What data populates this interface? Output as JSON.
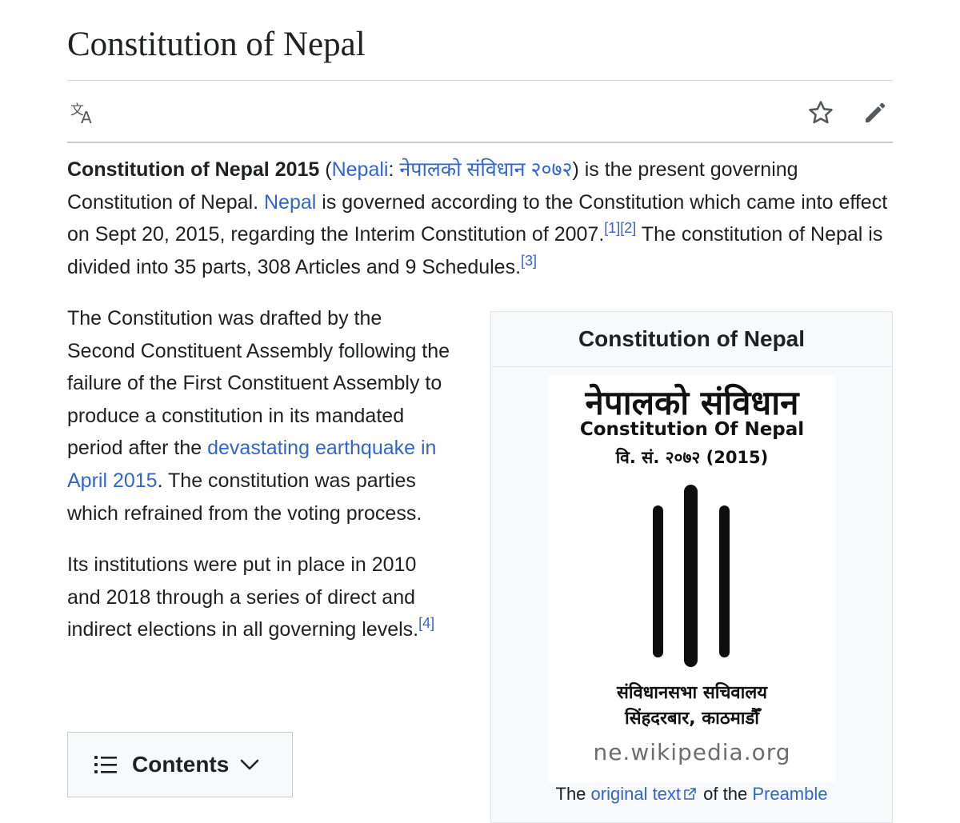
{
  "page": {
    "title": "Constitution of Nepal"
  },
  "toolbar": {
    "language_icon": "language-icon",
    "watch_icon": "star-icon",
    "edit_icon": "pencil-icon"
  },
  "intro": {
    "bold_title": "Constitution of Nepal 2015",
    "open_paren": " (",
    "lang_link": "Nepali",
    "colon": ": ",
    "native_link": "नेपालको संविधान २०७२",
    "after_native": ") is the present governing Constitution of Nepal. ",
    "nepal_link": "Nepal",
    "after_nepal": " is governed according to the Constitution which came into effect on Sept 20, 2015, regarding the Interim Constitution of 2007.",
    "ref1": "[1]",
    "ref2": "[2]",
    "after_refs": " The constitution of Nepal is divided into 35 parts, 308 Articles and 9 Schedules.",
    "ref3": "[3]"
  },
  "body": {
    "p1_before": "The Constitution was drafted by the Second Constituent Assembly following the failure of the First Constituent Assembly to produce a constitution in its mandated period after the ",
    "p1_link": "devastating earthquake in April 2015",
    "p1_after": ". The constitution was parties which refrained from the voting process.",
    "p2": "Its institutions were put in place in 2010 and 2018 through a series of direct and indirect elections in all governing levels.",
    "p2_ref": "[4]"
  },
  "toc": {
    "label": "Contents",
    "list_icon": "list-icon",
    "chevron_icon": "chevron-down-icon"
  },
  "infobox": {
    "title": "Constitution of Nepal",
    "image": {
      "line1": "नेपालको संविधान",
      "line2": "Constitution Of Nepal",
      "line3": "वि. सं. २०७२ (2015)",
      "line4": "संविधानसभा सचिवालय",
      "line5": "सिंहदरबार, काठमाडौँ",
      "watermark": "ne.wikipedia.org"
    },
    "caption_before": "The ",
    "caption_link1": "original text",
    "caption_mid": " of the ",
    "caption_link2": "Preamble"
  },
  "colors": {
    "link": "#3366cc",
    "text": "#202122",
    "infobox_bg": "#f8f9fa"
  }
}
